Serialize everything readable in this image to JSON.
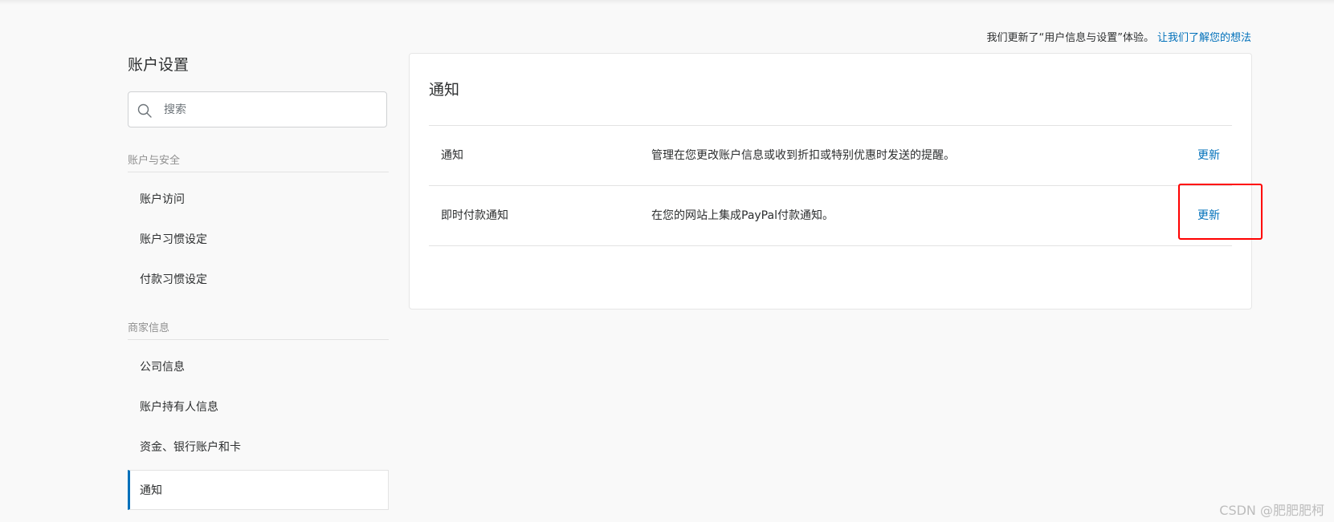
{
  "banner": {
    "text": "我们更新了“用户信息与设置”体验。",
    "link": "让我们了解您的想法"
  },
  "sidebar": {
    "title": "账户设置",
    "search_placeholder": "搜索",
    "sections": [
      {
        "header": "账户与安全",
        "items": [
          "账户访问",
          "账户习惯设定",
          "付款习惯设定"
        ]
      },
      {
        "header": "商家信息",
        "items": [
          "公司信息",
          "账户持有人信息",
          "资金、银行账户和卡",
          "通知"
        ]
      }
    ],
    "active_item": "通知"
  },
  "main": {
    "title": "通知",
    "rows": [
      {
        "name": "通知",
        "description": "管理在您更改账户信息或收到折扣或特别优惠时发送的提醒。",
        "action": "更新"
      },
      {
        "name": "即时付款通知",
        "description": "在您的网站上集成PayPal付款通知。",
        "action": "更新"
      }
    ]
  },
  "annotation": {
    "highlight_color": "#ff0000"
  },
  "watermark": "CSDN @肥肥肥柯",
  "colors": {
    "link": "#0070ba",
    "active_indicator": "#0070ba",
    "text": "#2c2e2f",
    "muted": "#8f8f8f"
  }
}
